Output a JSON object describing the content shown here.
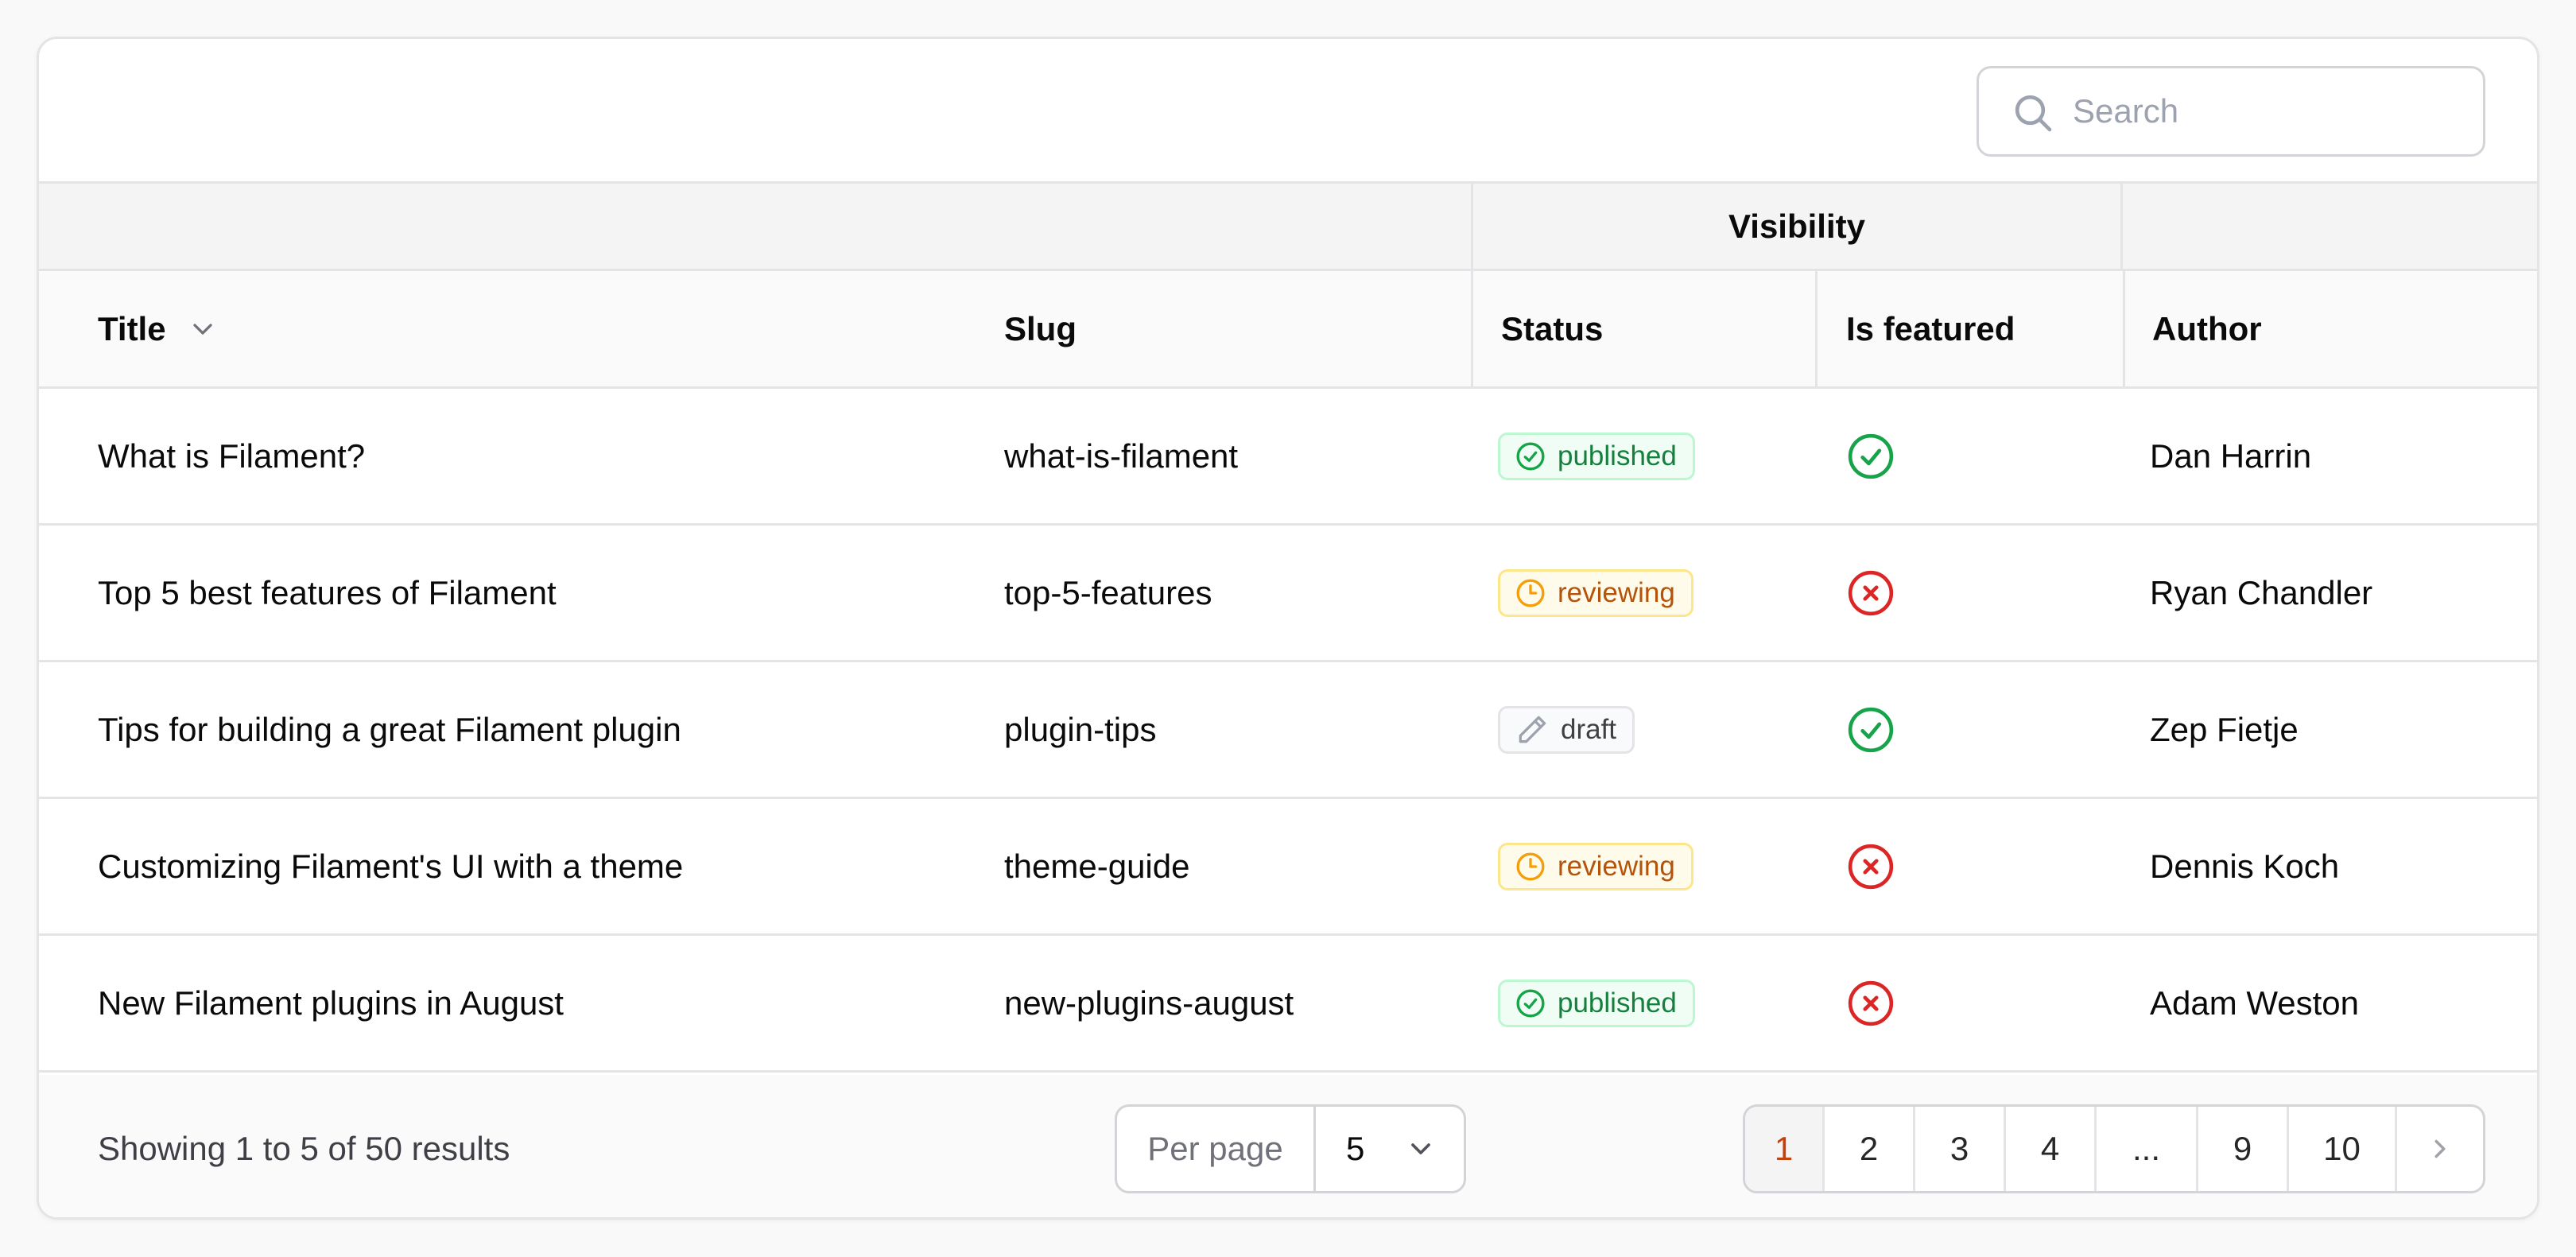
{
  "search": {
    "placeholder": "Search",
    "value": ""
  },
  "group_header": {
    "visibility": "Visibility"
  },
  "columns": {
    "title": "Title",
    "slug": "Slug",
    "status": "Status",
    "is_featured": "Is featured",
    "author": "Author"
  },
  "rows": [
    {
      "title": "What is Filament?",
      "slug": "what-is-filament",
      "status": "published",
      "featured": true,
      "author": "Dan Harrin"
    },
    {
      "title": "Top 5 best features of Filament",
      "slug": "top-5-features",
      "status": "reviewing",
      "featured": false,
      "author": "Ryan Chandler"
    },
    {
      "title": "Tips for building a great Filament plugin",
      "slug": "plugin-tips",
      "status": "draft",
      "featured": true,
      "author": "Zep Fietje"
    },
    {
      "title": "Customizing Filament's UI with a theme",
      "slug": "theme-guide",
      "status": "reviewing",
      "featured": false,
      "author": "Dennis Koch"
    },
    {
      "title": "New Filament plugins in August",
      "slug": "new-plugins-august",
      "status": "published",
      "featured": false,
      "author": "Adam Weston"
    }
  ],
  "icons": {
    "search": "search-icon",
    "sort": "chevron-down-icon",
    "published": "check-circle-icon",
    "reviewing": "clock-icon",
    "draft": "pencil-icon",
    "featured_true": "check-circle-icon",
    "featured_false": "x-circle-icon"
  },
  "colors": {
    "success": "#16a34a",
    "danger": "#dc2626",
    "warning": "#f59e0b",
    "active_page": "#c2410c"
  },
  "footer": {
    "showing": "Showing 1 to 5 of 50 results",
    "per_page_label": "Per page",
    "per_page_value": "5",
    "pages": [
      "1",
      "2",
      "3",
      "4",
      "...",
      "9",
      "10"
    ],
    "current_page": "1"
  }
}
